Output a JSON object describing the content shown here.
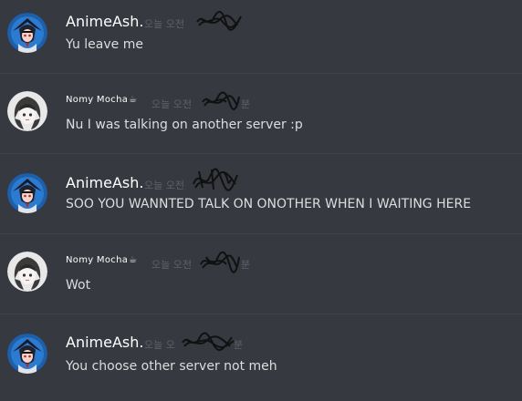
{
  "messages": [
    {
      "author": "AnimeAsh.",
      "timestamp": "오늘 오전",
      "timestamp_suffix": "",
      "text": "Yu leave me",
      "avatar": "anime-ash-avatar"
    },
    {
      "author": "Nomy Mocha",
      "author_badge": "☕",
      "timestamp": "오늘 오전",
      "timestamp_suffix": "분",
      "text": "Nu I was talking on another server :p",
      "avatar": "nomy-mocha-avatar"
    },
    {
      "author": "AnimeAsh.",
      "timestamp": "오늘 오전",
      "timestamp_suffix": "",
      "text": "SOO YOU WANNTED TALK ON ONOTHER WHEN I WAITING HERE",
      "avatar": "anime-ash-avatar"
    },
    {
      "author": "Nomy Mocha",
      "author_badge": "☕",
      "timestamp": "오늘 오전",
      "timestamp_suffix": "분",
      "text": "Wot",
      "avatar": "nomy-mocha-avatar"
    },
    {
      "author": "AnimeAsh.",
      "timestamp": "오늘 오",
      "timestamp_suffix": "분",
      "text": "You choose other server not meh",
      "avatar": "anime-ash-avatar"
    }
  ],
  "colors": {
    "background": "#36393f",
    "divider": "#40444b",
    "username": "#ffffff",
    "message_text": "#dcddde",
    "timestamp": "#72767d"
  }
}
